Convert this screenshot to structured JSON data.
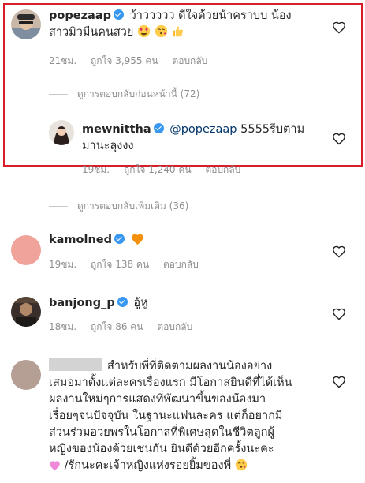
{
  "comments": [
    {
      "username": "popezaap",
      "text": "ว้าววววว ดีใจด้วยน้าคราบบ น้อง",
      "text_line2": "สาวมิวมีนคนสวย",
      "time": "21ชม.",
      "likes": "ถูกใจ 3,955 คน",
      "reply": "ตอบกลับ",
      "emoji": [
        "heart-eyes-emoji",
        "kiss-emoji",
        "thumbs-up-emoji"
      ]
    },
    {
      "username": "mewnittha",
      "mention": "@popezaap",
      "text": " 5555รีบตาม",
      "text_line2": "มานะลุงงง",
      "time": "19ชม.",
      "likes": "ถูกใจ 1,240 คน",
      "reply": "ตอบกลับ"
    },
    {
      "username": "kamolned",
      "time": "19ชม.",
      "likes": "ถูกใจ 138 คน",
      "reply": "ตอบกลับ",
      "emoji": [
        "orange-heart-emoji"
      ]
    },
    {
      "username": "banjong_p",
      "text": "อู้หู",
      "time": "18ชม.",
      "likes": "ถูกใจ 86 คน",
      "reply": "ตอบกลับ"
    },
    {
      "lines": [
        "สำหรับพี่ที่ติดตามผลงานน้องอย่าง",
        "เสมอมาตั้งแต่ละครเรื่องแรก มีโอกาสยินดีที่ได้เห็น",
        "ผลงานใหม่ๆการแสดงที่พัฒนาขึ้นของน้องมา",
        "เรื่อยๆจนปัจจุบัน ในฐานะแฟนละคร แต่ก็อยากมี",
        "ส่วนร่วมอวยพรในโอกาสที่พิเศษสุดในชีวิตลูกผู้",
        "หญิงของน้องด้วยเช่นกัน ยินดีด้วยอีกครั้งนะคะ",
        " /รักนะคะเจ้าหญิงแห่งรอยยิ้มของพี่"
      ]
    }
  ],
  "view_previous_replies": "ดูการตอบกลับก่อนหน้านี้ (72)",
  "view_more_replies": "ดูการตอบกลับเพิ่มเติม (36)",
  "colors": {
    "highlight_border": "#d81e2a",
    "verified_badge": "#3897f0",
    "avatar_kamolned": "#f0a39a"
  },
  "icons": {
    "like": "heart-outline-icon",
    "verified": "verified-badge-icon"
  }
}
